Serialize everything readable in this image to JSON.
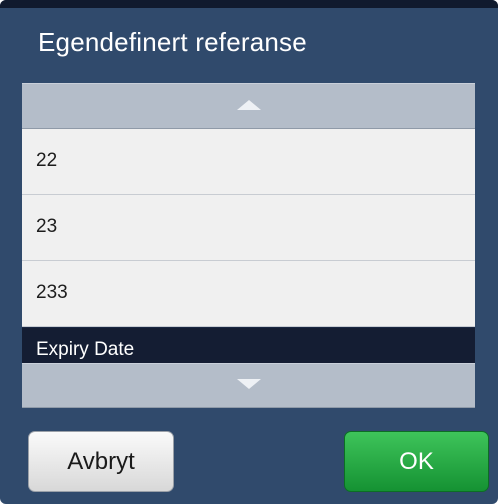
{
  "dialog": {
    "title": "Egendefinert referanse"
  },
  "list": {
    "scroll_up_icon": "triangle-up",
    "scroll_down_icon": "triangle-down",
    "items": [
      {
        "label": "22",
        "selected": false
      },
      {
        "label": "23",
        "selected": false
      },
      {
        "label": "233",
        "selected": false
      },
      {
        "label": "Expiry Date",
        "selected": true
      }
    ]
  },
  "buttons": {
    "cancel_label": "Avbryt",
    "ok_label": "OK"
  },
  "colors": {
    "dialog_background": "#304a6c",
    "selected_row": "#141d33",
    "ok_button": "#2bb048",
    "scroll_button": "#b4bdc9"
  }
}
